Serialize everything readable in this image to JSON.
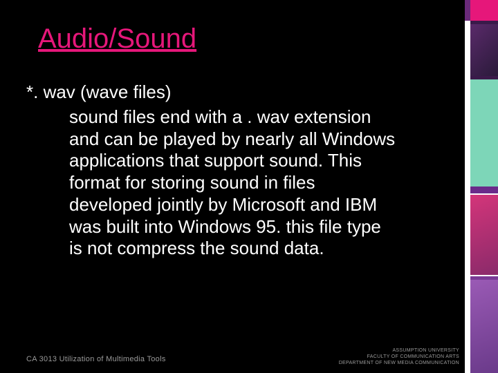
{
  "heading": "Audio/Sound",
  "lead": "*. wav (wave files)",
  "body": "sound files end with a . wav extension and can be played by nearly all Windows applications that support sound. This format for storing sound in files developed jointly by Microsoft and IBM was built into Windows 95. this file type is not compress the sound data.",
  "footer_left": "CA 3013 Utilization of Multimedia Tools",
  "footer_right_1": "ASSUMPTION UNIVERSITY",
  "footer_right_2": "FACULTY OF COMMUNICATION ARTS",
  "footer_right_3": "DEPARTMENT OF NEW MEDIA COMMUNICATION"
}
